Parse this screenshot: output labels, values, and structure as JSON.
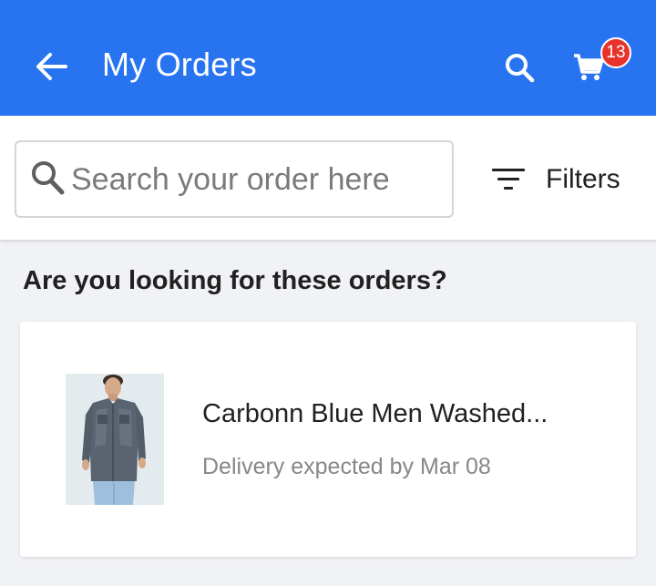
{
  "appbar": {
    "title": "My Orders",
    "cart_count": "13",
    "colors": {
      "primary": "#2874f0",
      "badge": "#e8332c"
    },
    "icons": [
      "back-arrow-icon",
      "search-icon",
      "cart-icon"
    ]
  },
  "search": {
    "placeholder": "Search your order here",
    "value": ""
  },
  "filters": {
    "label": "Filters",
    "icon": "filter-icon"
  },
  "suggestions": {
    "heading": "Are you looking for these orders?",
    "orders": [
      {
        "title": "Carbonn Blue Men Washed...",
        "status": "Delivery expected by Mar 08",
        "image": "denim-shirt-product-thumbnail"
      }
    ]
  }
}
